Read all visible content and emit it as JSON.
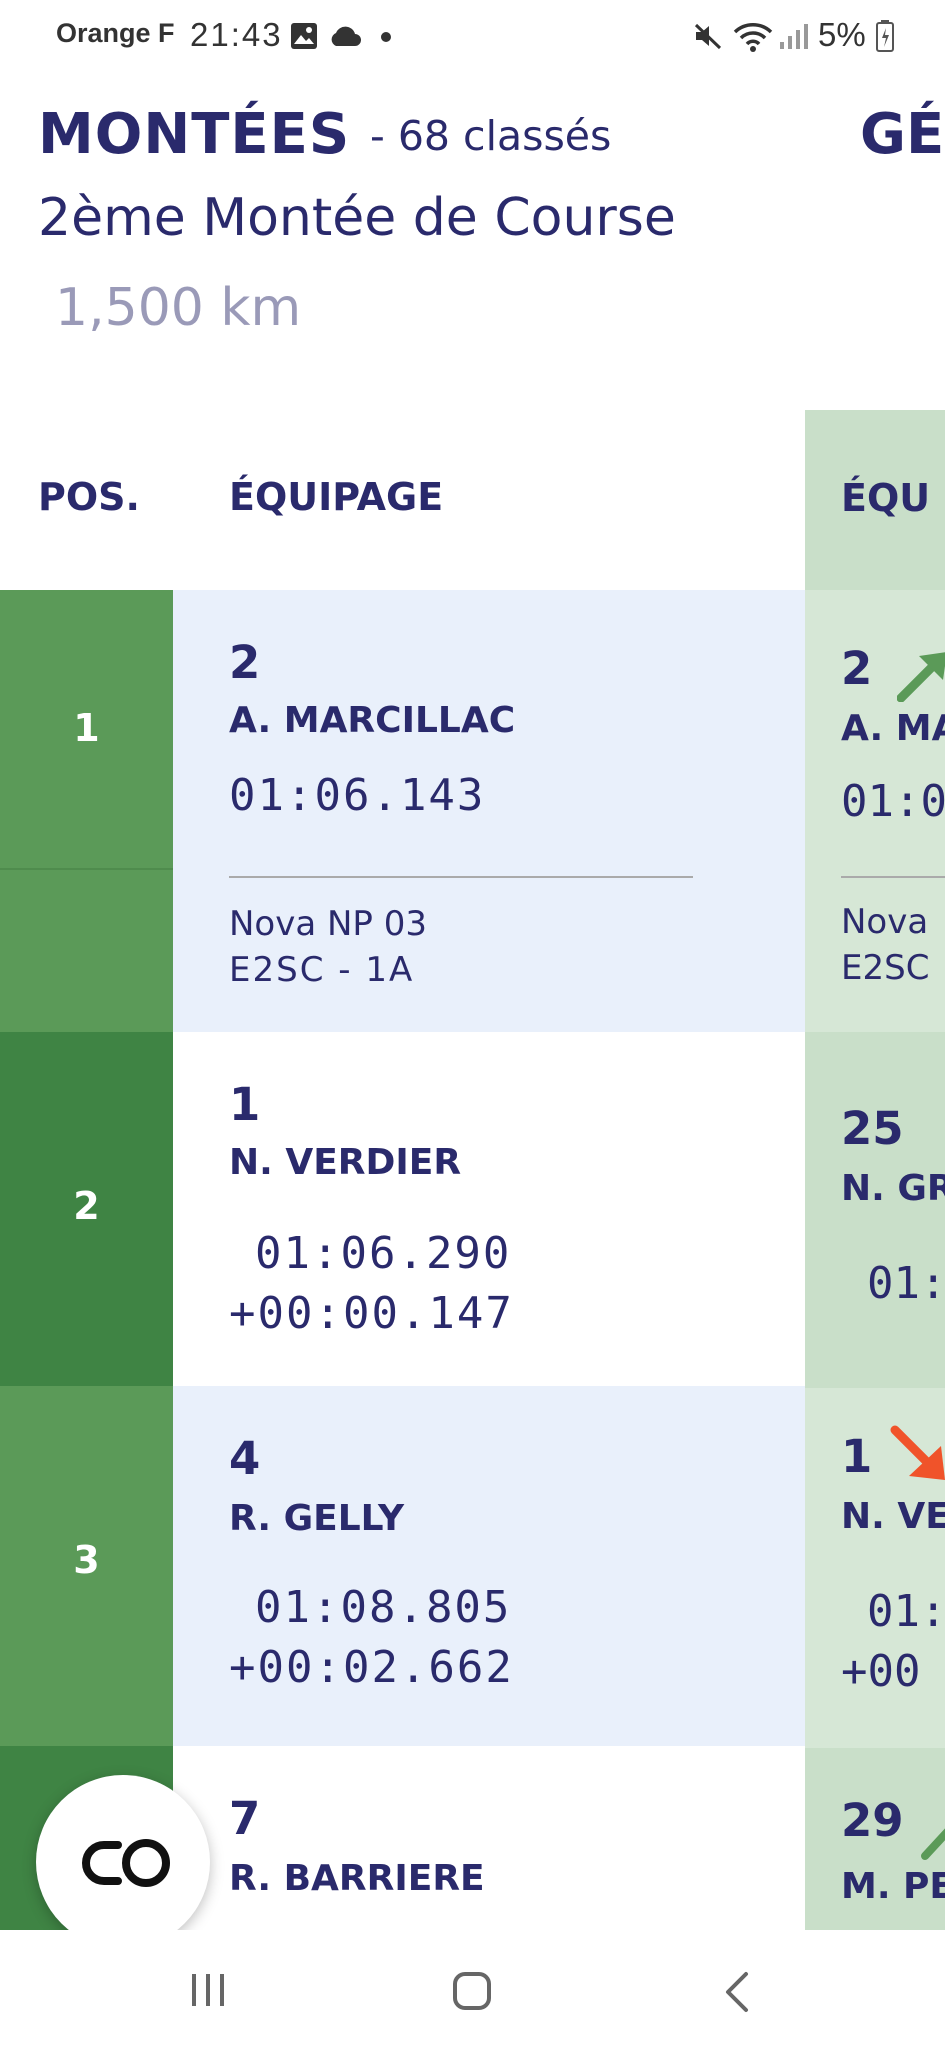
{
  "status_bar": {
    "carrier": "Orange F",
    "time": "21:43",
    "battery": "5%",
    "icons": [
      "gallery-icon",
      "cloud-icon",
      "dot-icon",
      "mute-icon",
      "wifi-icon",
      "signal-icon",
      "battery-icon"
    ]
  },
  "header": {
    "title": "MONTÉES",
    "count": "- 68 classés",
    "right_title_fragment": "GÉ",
    "subtitle": "2ème Montée de Course",
    "distance": "1,500 km"
  },
  "columns": {
    "pos": "POS.",
    "crew": "ÉQUIPAGE",
    "right_crew_fragment": "ÉQU"
  },
  "rows": [
    {
      "position": "1",
      "number": "2",
      "name": "A. MARCILLAC",
      "time": "01:06.143",
      "gap": "",
      "car": "Nova NP 03",
      "category": "E2SC - 1A"
    },
    {
      "position": "2",
      "number": "1",
      "name": "N. VERDIER",
      "time": "01:06.290",
      "gap": "+00:00.147"
    },
    {
      "position": "3",
      "number": "4",
      "name": "R. GELLY",
      "time": "01:08.805",
      "gap": "+00:02.662"
    },
    {
      "position": "",
      "number": "7",
      "name": "R. BARRIERE"
    }
  ],
  "right_column": {
    "rows": [
      {
        "number": "2",
        "name": "A. MA",
        "time": "01:0",
        "car": "Nova",
        "category": "E2SC",
        "trend": "up"
      },
      {
        "number": "25",
        "name": "N. GR",
        "time": "01:",
        "trend": ""
      },
      {
        "number": "1",
        "name": "N. VE",
        "time": "01:",
        "gap": "+00",
        "trend": "down"
      },
      {
        "number": "29",
        "name": "M. PE",
        "trend": "up"
      }
    ]
  },
  "fab": {
    "icon": "link-icon"
  },
  "nav": {
    "icons": [
      "recent-apps-icon",
      "home-icon",
      "back-icon"
    ]
  },
  "colors": {
    "text": "#2a2a6c",
    "pos_green_light": "#5b9a58",
    "pos_green_dark": "#3f8444",
    "row_highlight": "#e9f0fb",
    "right_strip": "#c9dfc9",
    "arrow_up": "#5b9a58",
    "arrow_down": "#f0532a"
  }
}
